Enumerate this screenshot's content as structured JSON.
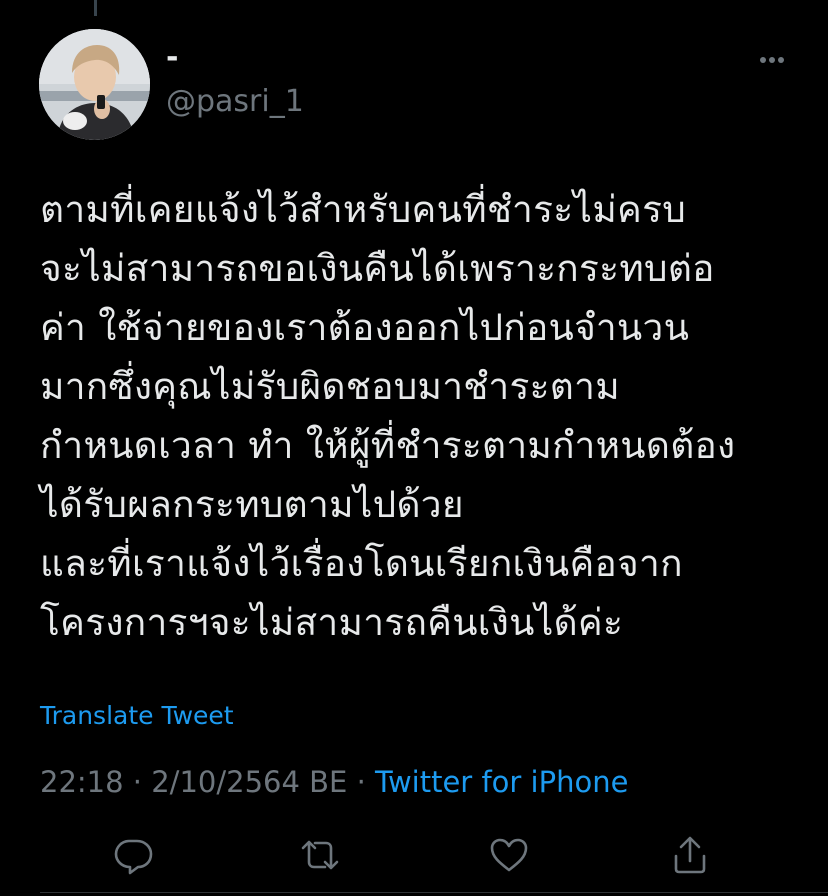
{
  "tweet": {
    "author": {
      "display_name": "-",
      "handle": "@pasri_1"
    },
    "text_lines": [
      "ตามที่เคยแจ้งไว้สำหรับคนที่ชำระไม่ครบ",
      "จะไม่สามารถขอเงินคืนได้เพราะกระทบต่อ",
      "ค่า ใช้จ่ายของเราต้องออกไปก่อนจำนวน",
      "มากซึ่งคุณไม่รับผิดชอบมาชำระตาม",
      "กำหนดเวลา ทำ ให้ผู้ที่ชำระตามกำหนดต้อง",
      "ได้รับผลกระทบตามไปด้วย",
      "และที่เราแจ้งไว้เรื่องโดนเรียกเงินคือจาก",
      "โครงการฯจะไม่สามารถคืนเงินได้ค่ะ"
    ],
    "translate_label": "Translate Tweet",
    "time": "22:18",
    "separator": " · ",
    "date": "2/10/2564 BE",
    "source": "Twitter for iPhone"
  },
  "actions": {
    "reply_icon": "speech-bubble",
    "retweet_icon": "retweet-arrows",
    "like_icon": "heart-outline",
    "share_icon": "share-arrow-up"
  },
  "colors": {
    "background": "#000000",
    "text": "#e7e9ea",
    "muted": "#6e767d",
    "link": "#1d9bf0"
  }
}
